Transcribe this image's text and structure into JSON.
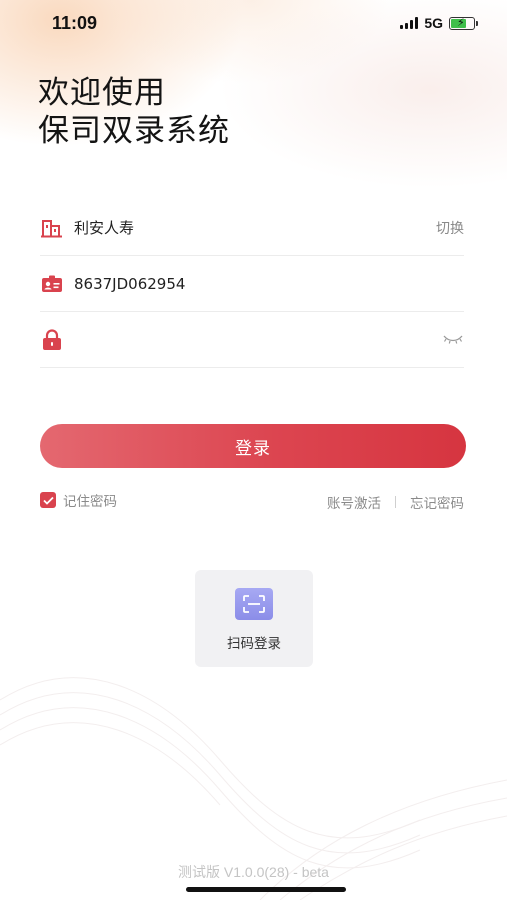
{
  "status_bar": {
    "time": "11:09",
    "network": "5G",
    "battery_level": 0.7
  },
  "title": {
    "line1": "欢迎使用",
    "line2": "保司双录系统"
  },
  "company_row": {
    "icon": "building-icon",
    "value": "利安人寿",
    "switch_label": "切换"
  },
  "account_row": {
    "icon": "id-card-icon",
    "value": "8637JD062954"
  },
  "password_row": {
    "icon": "lock-icon",
    "value": "",
    "toggle_icon": "eye-closed-icon"
  },
  "login_button": {
    "label": "登录"
  },
  "options": {
    "remember_label": "记住密码",
    "remember_checked": true,
    "activate_label": "账号激活",
    "forgot_label": "忘记密码"
  },
  "scan_login": {
    "icon": "scan-icon",
    "label": "扫码登录"
  },
  "footer": {
    "version": "测试版 V1.0.0(28) - beta"
  },
  "colors": {
    "accent": "#d9434e",
    "scan_icon_bg": "#9a9cec",
    "muted_text": "#8a8a8a"
  }
}
